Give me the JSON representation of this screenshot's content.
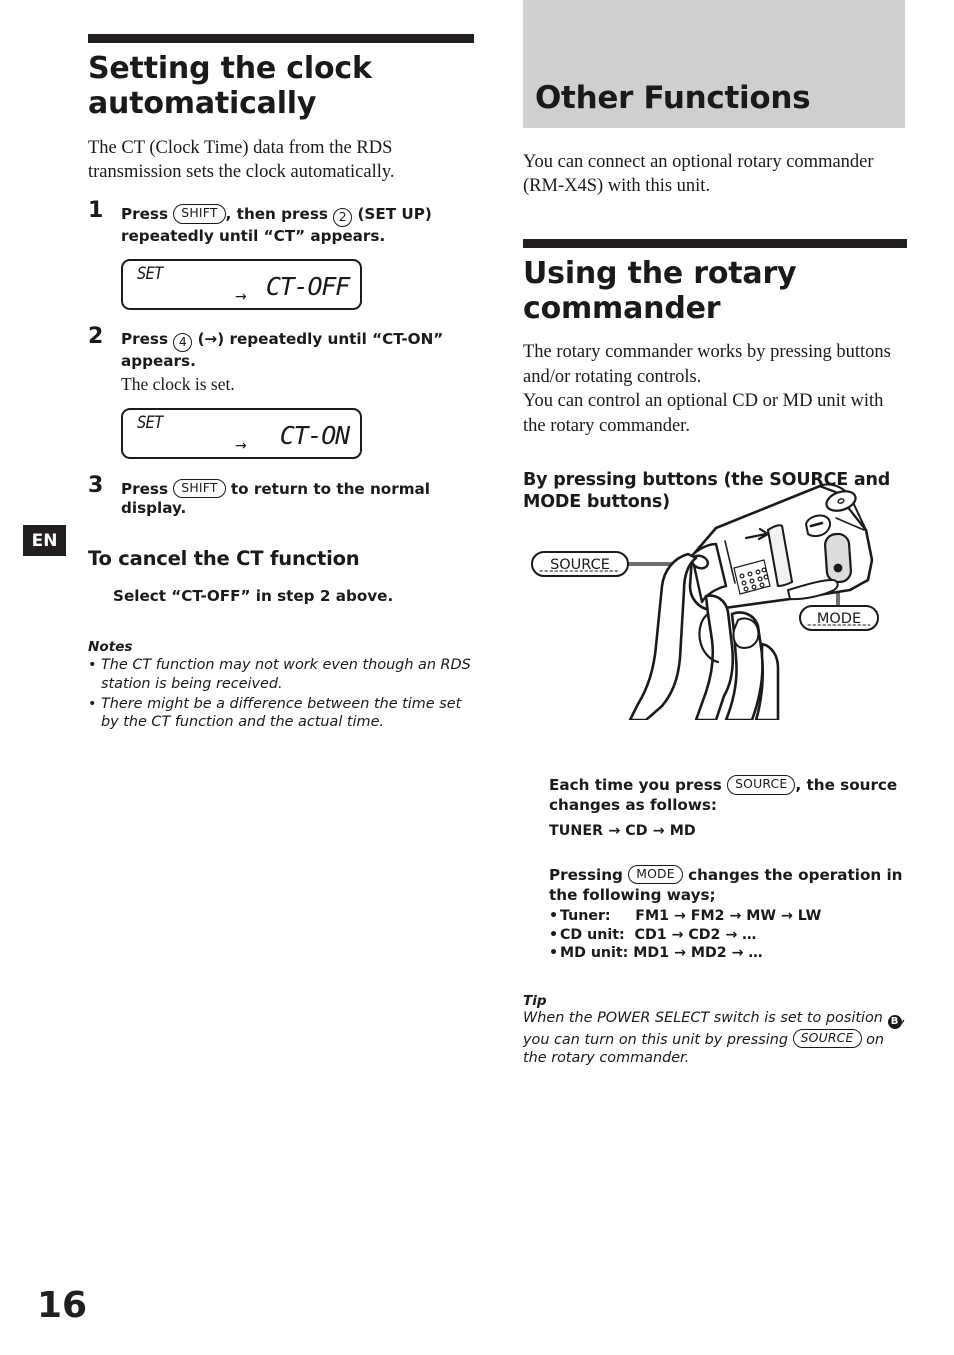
{
  "page": {
    "number": "16",
    "language_tab": "EN"
  },
  "left": {
    "heading": "Setting the clock automatically",
    "intro": "The CT (Clock Time) data from the RDS transmission sets the clock automatically.",
    "steps": [
      {
        "number": "1",
        "pre": "Press ",
        "key1": "SHIFT",
        "mid": ", then press ",
        "key2": "2",
        "post": " (SET UP) repeatedly until “CT” appears.",
        "sub": ""
      },
      {
        "number": "2",
        "pre": "Press ",
        "key1": "4",
        "mid": " (→) repeatedly until “CT-ON” appears.",
        "key2": "",
        "post": "",
        "sub": "The clock is set."
      },
      {
        "number": "3",
        "pre": "Press ",
        "key1": "SHIFT",
        "mid": " to return to the normal display.",
        "key2": "",
        "post": "",
        "sub": ""
      }
    ],
    "lcd_1": {
      "left_text": "SET",
      "main_text": "CT-OFF",
      "arrow": "→"
    },
    "lcd_2": {
      "left_text": "SET",
      "main_text": "CT-ON",
      "arrow": "→"
    },
    "cancel_heading": "To cancel the CT function",
    "cancel_body": "Select “CT-OFF” in step 2 above.",
    "notes_title": "Notes",
    "notes": [
      "The CT function may not work even though an RDS station is being received.",
      "There might be a difference between the time set by the CT function and the actual time."
    ]
  },
  "right": {
    "chapter_title": "Other Functions",
    "chapter_intro": "You can connect an optional rotary commander (RM-X4S) with this unit.",
    "section_heading": "Using the rotary commander",
    "section_intro": "The rotary commander works by pressing buttons and/or rotating controls.\nYou can control an optional CD or MD unit with the rotary commander.",
    "subsection_heading": "By pressing buttons (the SOURCE and MODE buttons)",
    "illustration": {
      "callout_source": "SOURCE",
      "callout_mode": "MODE"
    },
    "source_block": {
      "pre": "Each time you press ",
      "key": "SOURCE",
      "post": ", the source changes as follows:",
      "sequence": "TUNER → CD → MD"
    },
    "mode_block": {
      "pre": "Pressing ",
      "key": "MODE",
      "post": " changes the operation in the following ways;",
      "items": [
        "Tuner:     FM1 → FM2 → MW → LW",
        "CD unit:  CD1 → CD2 → …",
        "MD unit: MD1 → MD2 → …"
      ]
    },
    "tip": {
      "title": "Tip",
      "part1": "When the POWER SELECT switch is set to position ",
      "badge": "B",
      "part2": ", you can turn on this unit by pressing ",
      "key": "SOURCE",
      "part3": " on the rotary commander."
    }
  },
  "colors": {
    "ink": "#1a1a1a",
    "banner_gray": "#cfcfcf",
    "tab_dark": "#231f20"
  }
}
